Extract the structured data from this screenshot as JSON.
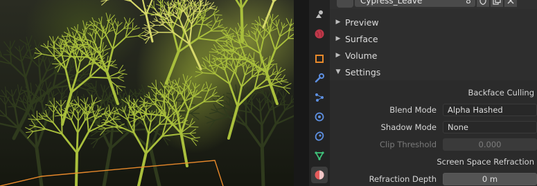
{
  "header": {
    "material_name": "Cypress_Leave",
    "user_count": "8"
  },
  "tabs": [
    {
      "name": "scene"
    },
    {
      "name": "world"
    },
    {
      "name": "object"
    },
    {
      "name": "modifiers"
    },
    {
      "name": "particles"
    },
    {
      "name": "physics"
    },
    {
      "name": "constraints"
    },
    {
      "name": "data"
    },
    {
      "name": "material"
    }
  ],
  "sections": {
    "preview": "Preview",
    "surface": "Surface",
    "volume": "Volume",
    "settings": "Settings"
  },
  "settings": {
    "backface_culling": "Backface Culling",
    "blend_mode_label": "Blend Mode",
    "blend_mode_value": "Alpha Hashed",
    "shadow_mode_label": "Shadow Mode",
    "shadow_mode_value": "None",
    "clip_threshold_label": "Clip Threshold",
    "clip_threshold_value": "0.000",
    "ssr_label": "Screen Space Refraction",
    "refraction_depth_label": "Refraction Depth",
    "refraction_depth_value": "0 m"
  },
  "colors": {
    "selection_outline": "#e8892b",
    "material_tab_accent": "#e45b5b"
  }
}
